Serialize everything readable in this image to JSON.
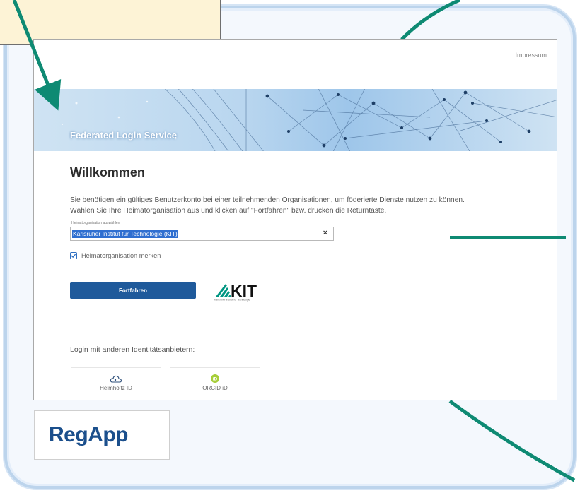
{
  "page": {
    "impressum": "Impressum",
    "banner_title": "Federated Login Service",
    "welcome_heading": "Willkommen",
    "intro_line1": "Sie benötigen ein gültiges Benutzerkonto bei einer teilnehmenden Organisationen, um föderierte Dienste nutzen zu können.",
    "intro_line2": "Wählen Sie Ihre Heimatorganisation aus und klicken auf \"Fortfahren\" bzw. drücken die Returntaste.",
    "select_label": "Heimatorganisation auswählen",
    "select_value": "Karlsruher Institut für Technologie (KIT)",
    "clear_symbol": "×",
    "remember_label": "Heimatorganisation merken",
    "remember_checked": true,
    "continue_button": "Fortfahren",
    "kit_logo_text": "KIT",
    "kit_logo_subtitle": "Karlsruher Institut für Technologie",
    "other_providers_label": "Login mit anderen Identitätsanbietern:",
    "providers": [
      {
        "label": "Helmholtz ID",
        "icon": "helmholtz-cloud-icon"
      },
      {
        "label": "ORCID iD",
        "icon": "orcid-icon"
      }
    ]
  },
  "overlay": {
    "regapp_label": "RegApp"
  },
  "colors": {
    "accent_arrow": "#0e8a73",
    "frame": "#bcd4ec",
    "primary_button": "#1f5a9b",
    "select_highlight": "#2f6fd0",
    "kit_green": "#009682",
    "regapp_text": "#1b4f8c",
    "orcid_green": "#a6ce39",
    "note_box": "#fdf3d6"
  }
}
